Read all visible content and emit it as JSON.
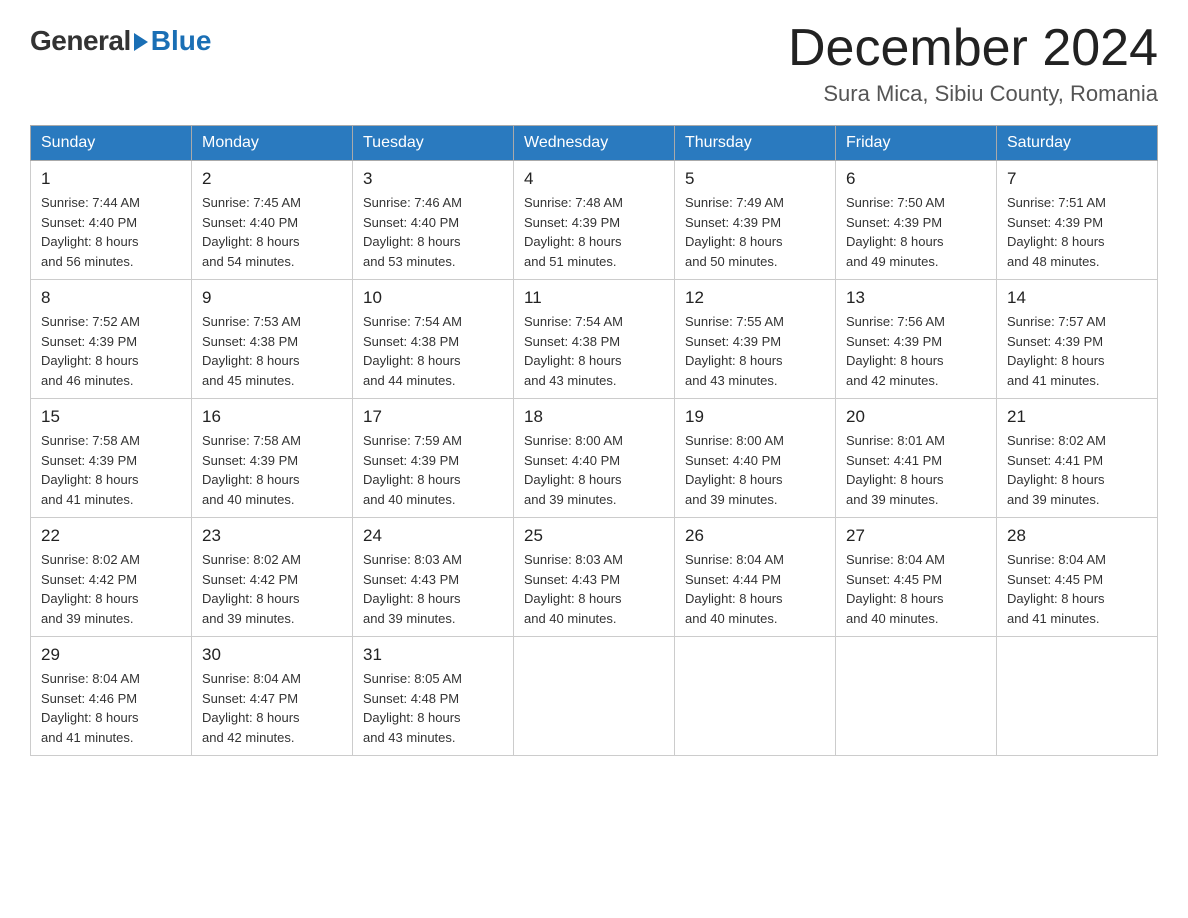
{
  "logo": {
    "general": "General",
    "blue": "Blue"
  },
  "title": "December 2024",
  "location": "Sura Mica, Sibiu County, Romania",
  "days_of_week": [
    "Sunday",
    "Monday",
    "Tuesday",
    "Wednesday",
    "Thursday",
    "Friday",
    "Saturday"
  ],
  "weeks": [
    [
      {
        "day": "1",
        "sunrise": "7:44 AM",
        "sunset": "4:40 PM",
        "daylight": "8 hours and 56 minutes."
      },
      {
        "day": "2",
        "sunrise": "7:45 AM",
        "sunset": "4:40 PM",
        "daylight": "8 hours and 54 minutes."
      },
      {
        "day": "3",
        "sunrise": "7:46 AM",
        "sunset": "4:40 PM",
        "daylight": "8 hours and 53 minutes."
      },
      {
        "day": "4",
        "sunrise": "7:48 AM",
        "sunset": "4:39 PM",
        "daylight": "8 hours and 51 minutes."
      },
      {
        "day": "5",
        "sunrise": "7:49 AM",
        "sunset": "4:39 PM",
        "daylight": "8 hours and 50 minutes."
      },
      {
        "day": "6",
        "sunrise": "7:50 AM",
        "sunset": "4:39 PM",
        "daylight": "8 hours and 49 minutes."
      },
      {
        "day": "7",
        "sunrise": "7:51 AM",
        "sunset": "4:39 PM",
        "daylight": "8 hours and 48 minutes."
      }
    ],
    [
      {
        "day": "8",
        "sunrise": "7:52 AM",
        "sunset": "4:39 PM",
        "daylight": "8 hours and 46 minutes."
      },
      {
        "day": "9",
        "sunrise": "7:53 AM",
        "sunset": "4:38 PM",
        "daylight": "8 hours and 45 minutes."
      },
      {
        "day": "10",
        "sunrise": "7:54 AM",
        "sunset": "4:38 PM",
        "daylight": "8 hours and 44 minutes."
      },
      {
        "day": "11",
        "sunrise": "7:54 AM",
        "sunset": "4:38 PM",
        "daylight": "8 hours and 43 minutes."
      },
      {
        "day": "12",
        "sunrise": "7:55 AM",
        "sunset": "4:39 PM",
        "daylight": "8 hours and 43 minutes."
      },
      {
        "day": "13",
        "sunrise": "7:56 AM",
        "sunset": "4:39 PM",
        "daylight": "8 hours and 42 minutes."
      },
      {
        "day": "14",
        "sunrise": "7:57 AM",
        "sunset": "4:39 PM",
        "daylight": "8 hours and 41 minutes."
      }
    ],
    [
      {
        "day": "15",
        "sunrise": "7:58 AM",
        "sunset": "4:39 PM",
        "daylight": "8 hours and 41 minutes."
      },
      {
        "day": "16",
        "sunrise": "7:58 AM",
        "sunset": "4:39 PM",
        "daylight": "8 hours and 40 minutes."
      },
      {
        "day": "17",
        "sunrise": "7:59 AM",
        "sunset": "4:39 PM",
        "daylight": "8 hours and 40 minutes."
      },
      {
        "day": "18",
        "sunrise": "8:00 AM",
        "sunset": "4:40 PM",
        "daylight": "8 hours and 39 minutes."
      },
      {
        "day": "19",
        "sunrise": "8:00 AM",
        "sunset": "4:40 PM",
        "daylight": "8 hours and 39 minutes."
      },
      {
        "day": "20",
        "sunrise": "8:01 AM",
        "sunset": "4:41 PM",
        "daylight": "8 hours and 39 minutes."
      },
      {
        "day": "21",
        "sunrise": "8:02 AM",
        "sunset": "4:41 PM",
        "daylight": "8 hours and 39 minutes."
      }
    ],
    [
      {
        "day": "22",
        "sunrise": "8:02 AM",
        "sunset": "4:42 PM",
        "daylight": "8 hours and 39 minutes."
      },
      {
        "day": "23",
        "sunrise": "8:02 AM",
        "sunset": "4:42 PM",
        "daylight": "8 hours and 39 minutes."
      },
      {
        "day": "24",
        "sunrise": "8:03 AM",
        "sunset": "4:43 PM",
        "daylight": "8 hours and 39 minutes."
      },
      {
        "day": "25",
        "sunrise": "8:03 AM",
        "sunset": "4:43 PM",
        "daylight": "8 hours and 40 minutes."
      },
      {
        "day": "26",
        "sunrise": "8:04 AM",
        "sunset": "4:44 PM",
        "daylight": "8 hours and 40 minutes."
      },
      {
        "day": "27",
        "sunrise": "8:04 AM",
        "sunset": "4:45 PM",
        "daylight": "8 hours and 40 minutes."
      },
      {
        "day": "28",
        "sunrise": "8:04 AM",
        "sunset": "4:45 PM",
        "daylight": "8 hours and 41 minutes."
      }
    ],
    [
      {
        "day": "29",
        "sunrise": "8:04 AM",
        "sunset": "4:46 PM",
        "daylight": "8 hours and 41 minutes."
      },
      {
        "day": "30",
        "sunrise": "8:04 AM",
        "sunset": "4:47 PM",
        "daylight": "8 hours and 42 minutes."
      },
      {
        "day": "31",
        "sunrise": "8:05 AM",
        "sunset": "4:48 PM",
        "daylight": "8 hours and 43 minutes."
      },
      null,
      null,
      null,
      null
    ]
  ]
}
